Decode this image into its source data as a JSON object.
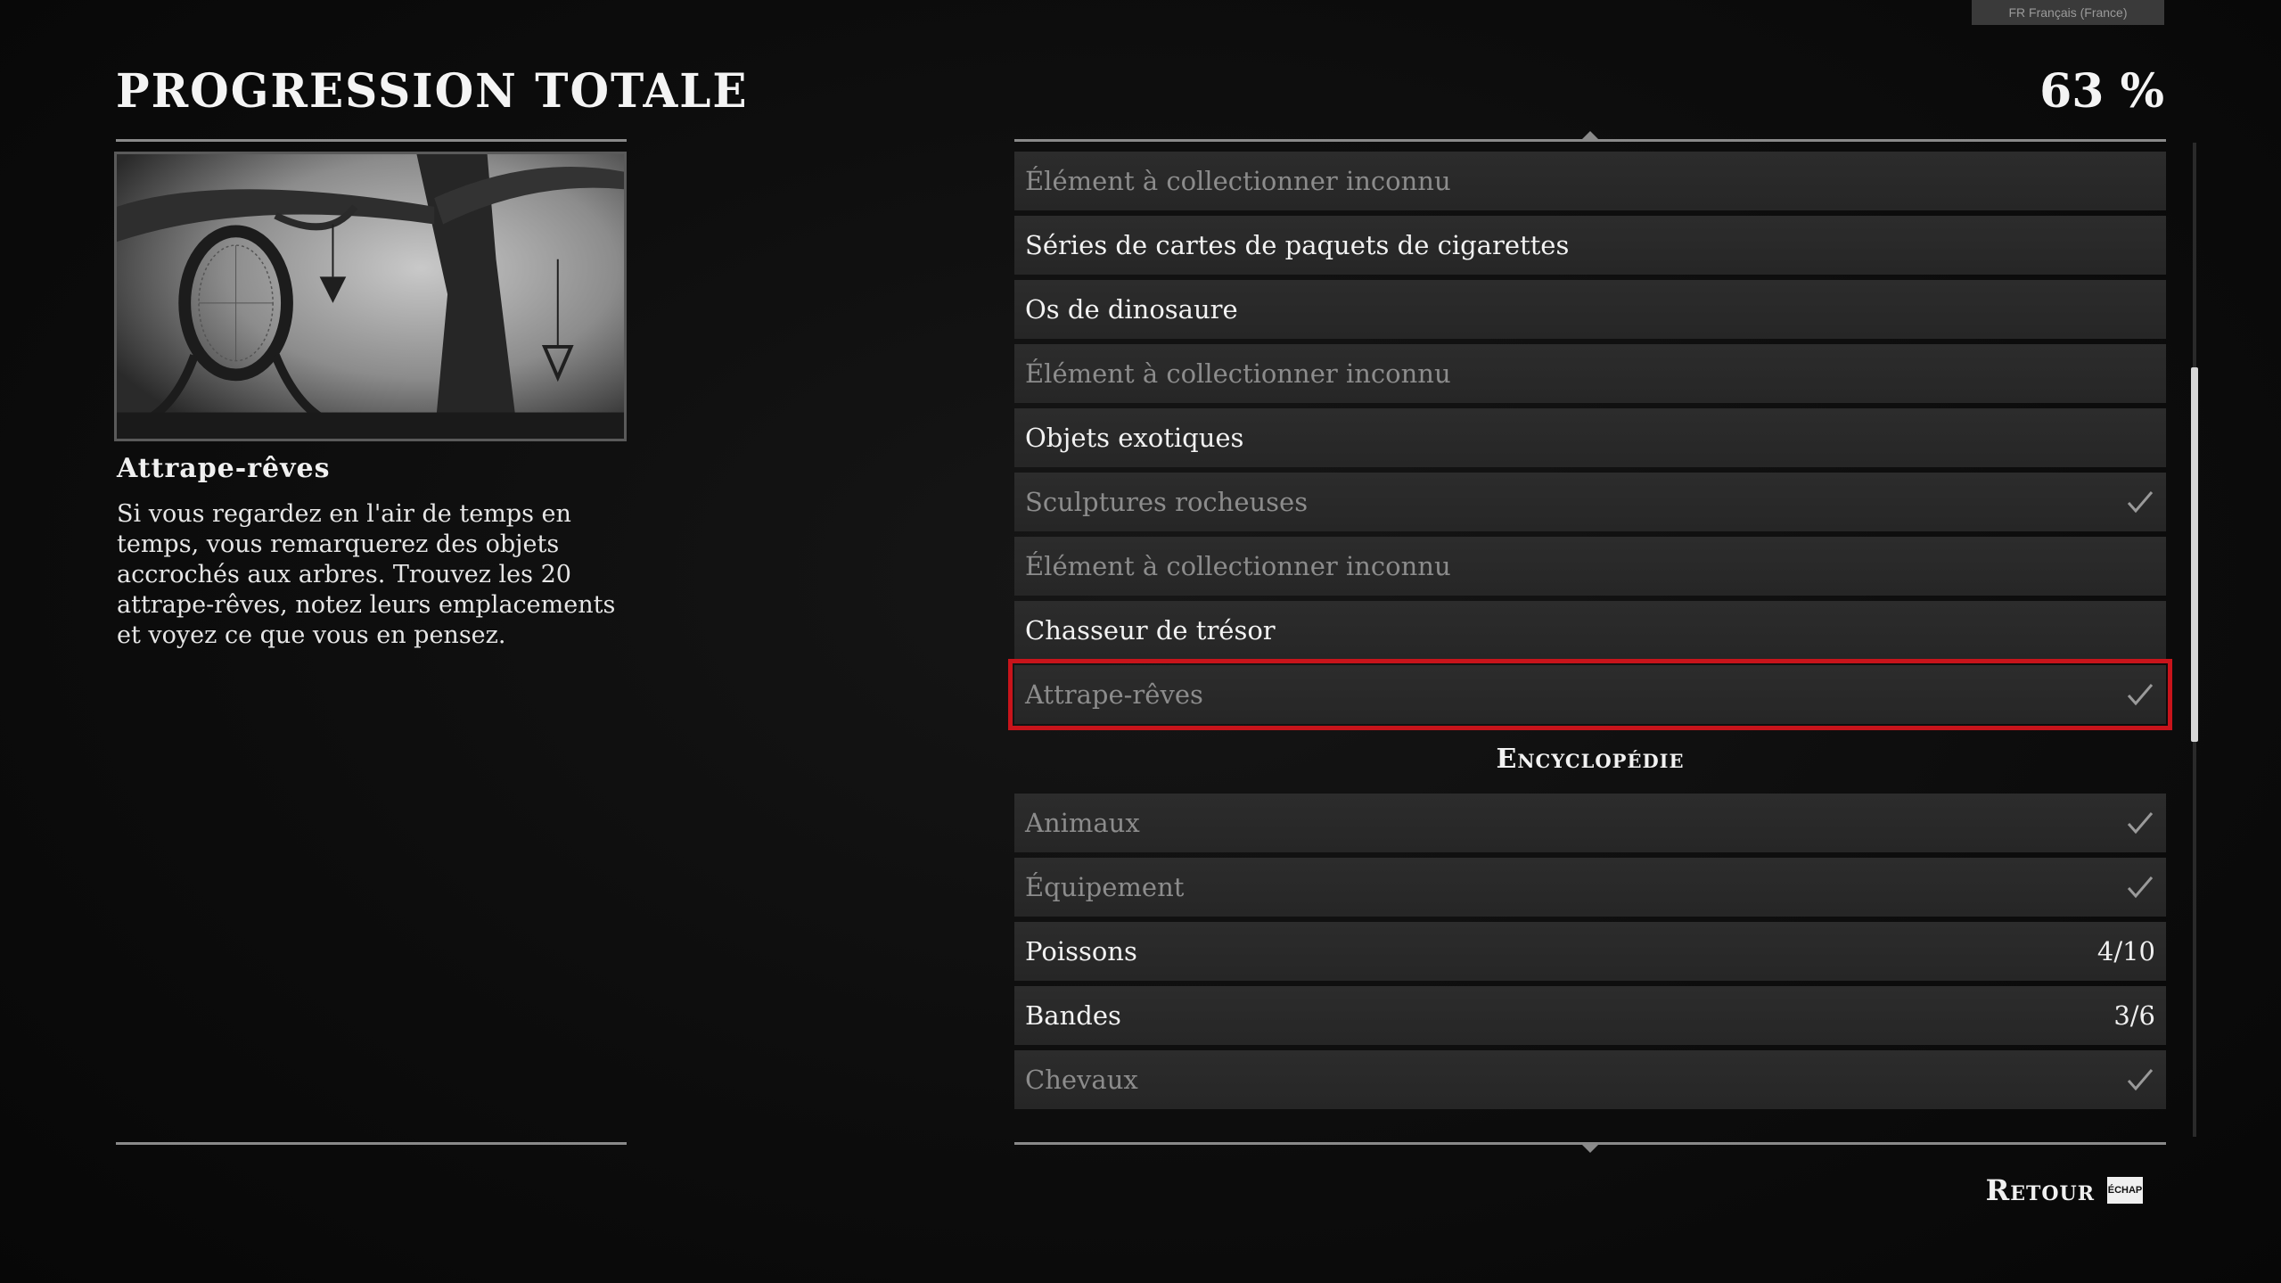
{
  "language_badge": "FR Français (France)",
  "header": {
    "title": "PROGRESSION TOTALE",
    "percent": "63 %"
  },
  "detail": {
    "title": "Attrape-rêves",
    "description": "Si vous regardez en l'air de temps en temps, vous remarquerez des objets accrochés aux arbres. Trouvez les 20 attrape-rêves, notez leurs emplacements et voyez ce que vous en pensez."
  },
  "rows": [
    {
      "label": "Élément à collectionner inconnu",
      "state": "dim",
      "status": ""
    },
    {
      "label": "Séries de cartes de paquets de cigarettes",
      "state": "bright",
      "status": ""
    },
    {
      "label": "Os de dinosaure",
      "state": "bright",
      "status": ""
    },
    {
      "label": "Élément à collectionner inconnu",
      "state": "dim",
      "status": ""
    },
    {
      "label": "Objets exotiques",
      "state": "bright",
      "status": ""
    },
    {
      "label": "Sculptures rocheuses",
      "state": "dim",
      "status": "check"
    },
    {
      "label": "Élément à collectionner inconnu",
      "state": "dim",
      "status": ""
    },
    {
      "label": "Chasseur de trésor",
      "state": "bright",
      "status": ""
    },
    {
      "label": "Attrape-rêves",
      "state": "dim",
      "status": "check",
      "selected": true
    }
  ],
  "section": {
    "title": "Encyclopédie"
  },
  "encyclopedia_rows": [
    {
      "label": "Animaux",
      "state": "dim",
      "status": "check"
    },
    {
      "label": "Équipement",
      "state": "dim",
      "status": "check"
    },
    {
      "label": "Poissons",
      "state": "bright",
      "status": "4/10"
    },
    {
      "label": "Bandes",
      "state": "bright",
      "status": "3/6"
    },
    {
      "label": "Chevaux",
      "state": "dim",
      "status": "check"
    }
  ],
  "footer": {
    "back_label": "Retour",
    "key_label": "ÉCHAP"
  },
  "colors": {
    "selection": "#c8141b",
    "text_bright": "#f2f2f2",
    "text_dim": "#8c8c8c"
  },
  "icons": {
    "check": "checkmark-icon"
  }
}
